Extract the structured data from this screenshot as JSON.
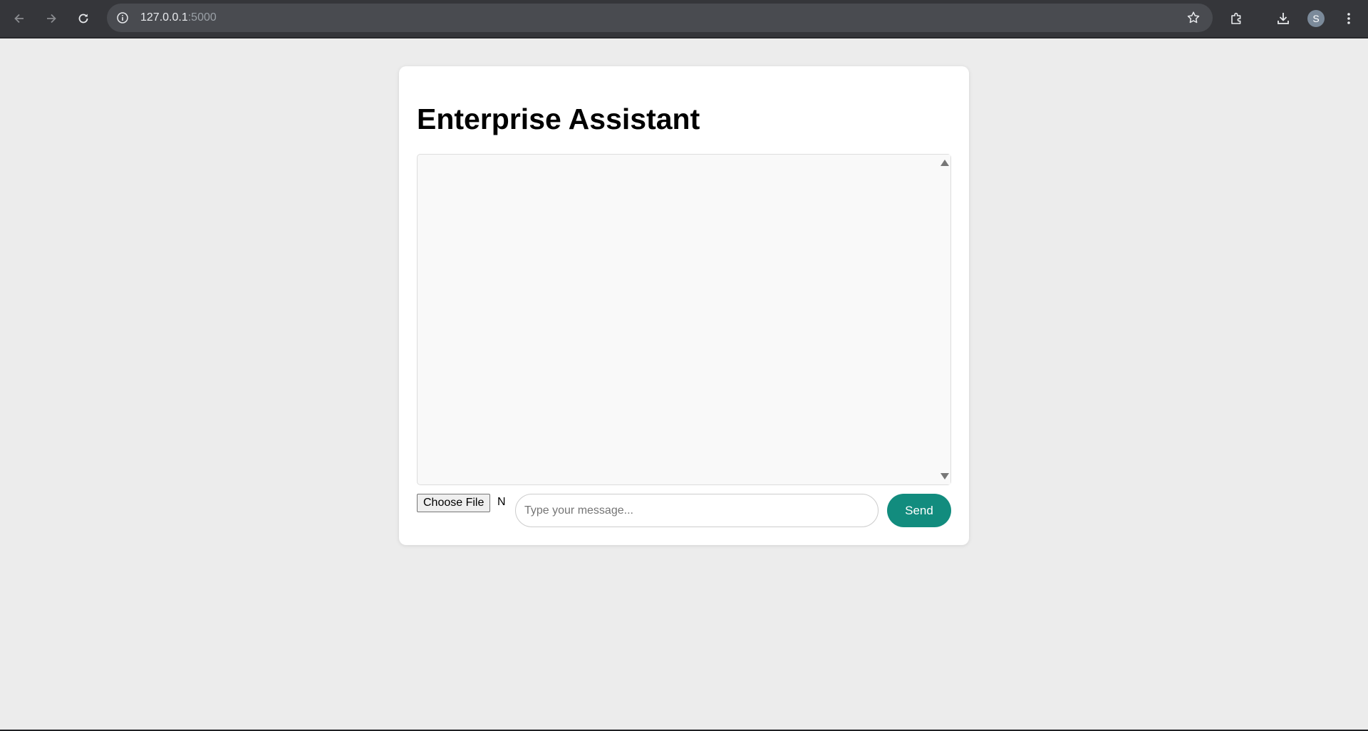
{
  "browser": {
    "url_host": "127.0.0.1",
    "url_port": ":5000",
    "avatar_letter": "S",
    "icons": {
      "back": "back-arrow-icon",
      "forward": "forward-arrow-icon",
      "reload": "reload-icon",
      "site_info": "info-icon",
      "bookmark": "star-icon",
      "extensions": "puzzle-icon",
      "downloads": "download-icon",
      "menu": "kebab-menu-icon"
    }
  },
  "page": {
    "title": "Enterprise Assistant",
    "chat_messages": [],
    "file_input": {
      "button_label": "Choose File",
      "status_text": "N"
    },
    "message_input": {
      "placeholder": "Type your message...",
      "value": ""
    },
    "send_label": "Send",
    "colors": {
      "background": "#ececec",
      "card": "#ffffff",
      "chat_box": "#f9f9f9",
      "send_button": "#128c7e"
    }
  }
}
